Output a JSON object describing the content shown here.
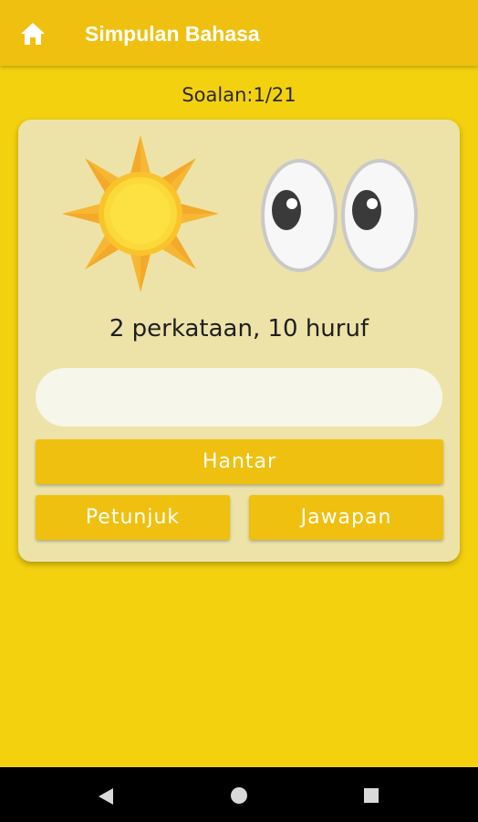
{
  "appbar": {
    "title": "Simpulan Bahasa",
    "home_icon": "home-icon"
  },
  "progress": {
    "label": "Soalan:1/21",
    "current": 1,
    "total": 21
  },
  "puzzle": {
    "pictures": [
      "sun-image",
      "eyes-image"
    ],
    "clue": "2 perkataan, 10 huruf",
    "answer_value": "",
    "answer_placeholder": ""
  },
  "buttons": {
    "submit": "Hantar",
    "hint": "Petunjuk",
    "answer": "Jawapan"
  },
  "navbar": {
    "icons": [
      "back-icon",
      "home-circle-icon",
      "recents-icon"
    ]
  },
  "colors": {
    "background": "#f3d10f",
    "appbar": "#efc00f",
    "card": "#ede3a8",
    "button": "#efc00f",
    "input": "#f7f6ea",
    "navbar": "#000000"
  }
}
